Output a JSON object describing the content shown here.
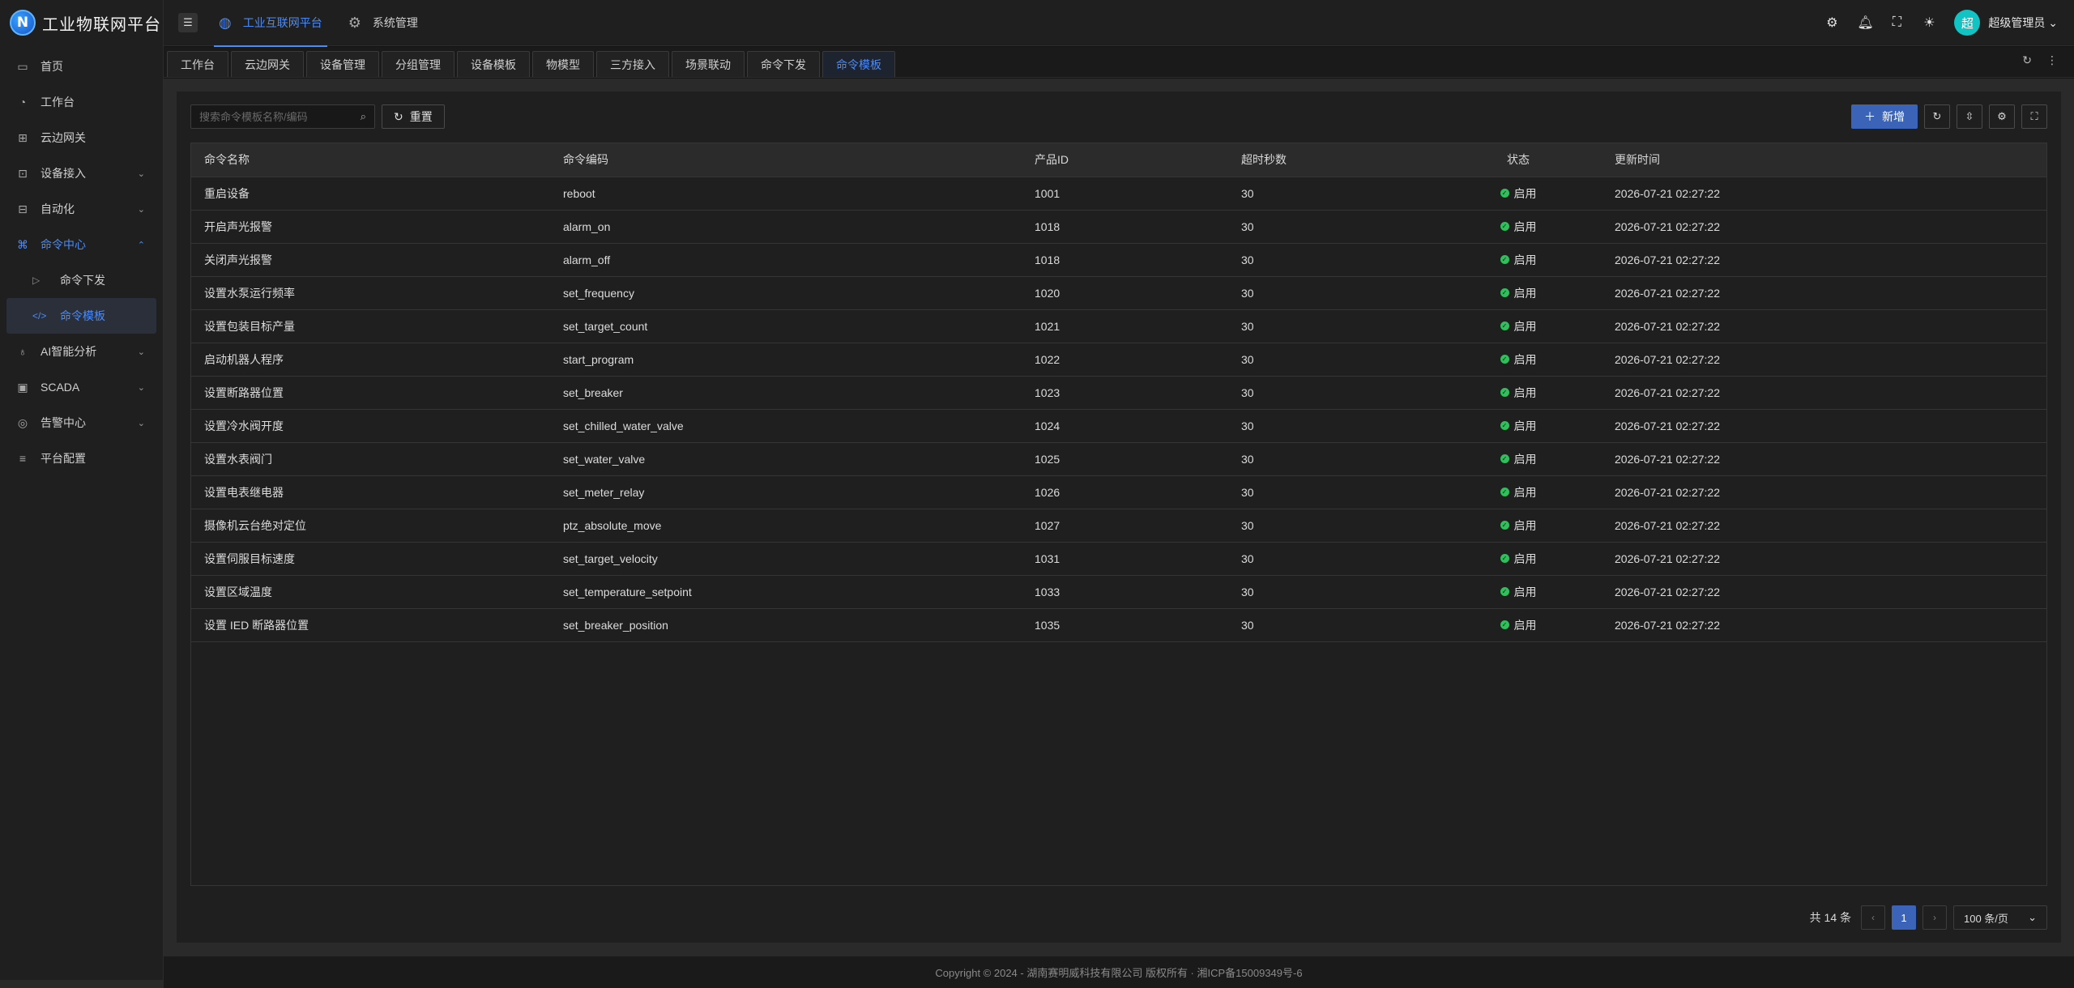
{
  "app": {
    "title": "工业物联网平台",
    "logo_letter": "N"
  },
  "sidebar": {
    "items": [
      {
        "label": "首页",
        "icon": "monitor-icon"
      },
      {
        "label": "工作台",
        "icon": "dashboard-icon"
      },
      {
        "label": "云边网关",
        "icon": "gateway-icon"
      },
      {
        "label": "设备接入",
        "icon": "device-icon",
        "expandable": true
      },
      {
        "label": "自动化",
        "icon": "automation-icon",
        "expandable": true
      },
      {
        "label": "命令中心",
        "icon": "command-icon",
        "expandable": true,
        "expanded": true,
        "children": [
          {
            "label": "命令下发",
            "icon": "send-icon"
          },
          {
            "label": "命令模板",
            "icon": "code-icon",
            "active": true
          }
        ]
      },
      {
        "label": "AI智能分析",
        "icon": "bulb-icon",
        "expandable": true
      },
      {
        "label": "SCADA",
        "icon": "scada-icon",
        "expandable": true
      },
      {
        "label": "告警中心",
        "icon": "alarm-icon",
        "expandable": true
      },
      {
        "label": "平台配置",
        "icon": "sliders-icon"
      }
    ]
  },
  "header": {
    "tabs": [
      {
        "label": "工业互联网平台",
        "icon": "platform-icon",
        "active": true
      },
      {
        "label": "系统管理",
        "icon": "gear-icon"
      }
    ],
    "user": {
      "avatar_text": "超",
      "name": "超级管理员"
    },
    "icons": [
      "settings-icon",
      "bell-icon",
      "fullscreen-icon",
      "theme-icon"
    ]
  },
  "tabs": [
    "工作台",
    "云边网关",
    "设备管理",
    "分组管理",
    "设备模板",
    "物模型",
    "三方接入",
    "场景联动",
    "命令下发",
    "命令模板"
  ],
  "active_tab": "命令模板",
  "toolbar": {
    "search_placeholder": "搜索命令模板名称/编码",
    "reset_label": "重置",
    "add_label": "新增"
  },
  "table": {
    "columns": [
      "命令名称",
      "命令编码",
      "产品ID",
      "超时秒数",
      "状态",
      "更新时间"
    ],
    "rows": [
      {
        "name": "重启设备",
        "code": "reboot",
        "product_id": "1001",
        "timeout": "30",
        "status": "启用",
        "updated": "2026-07-21 02:27:22"
      },
      {
        "name": "开启声光报警",
        "code": "alarm_on",
        "product_id": "1018",
        "timeout": "30",
        "status": "启用",
        "updated": "2026-07-21 02:27:22"
      },
      {
        "name": "关闭声光报警",
        "code": "alarm_off",
        "product_id": "1018",
        "timeout": "30",
        "status": "启用",
        "updated": "2026-07-21 02:27:22"
      },
      {
        "name": "设置水泵运行频率",
        "code": "set_frequency",
        "product_id": "1020",
        "timeout": "30",
        "status": "启用",
        "updated": "2026-07-21 02:27:22"
      },
      {
        "name": "设置包装目标产量",
        "code": "set_target_count",
        "product_id": "1021",
        "timeout": "30",
        "status": "启用",
        "updated": "2026-07-21 02:27:22"
      },
      {
        "name": "启动机器人程序",
        "code": "start_program",
        "product_id": "1022",
        "timeout": "30",
        "status": "启用",
        "updated": "2026-07-21 02:27:22"
      },
      {
        "name": "设置断路器位置",
        "code": "set_breaker",
        "product_id": "1023",
        "timeout": "30",
        "status": "启用",
        "updated": "2026-07-21 02:27:22"
      },
      {
        "name": "设置冷水阀开度",
        "code": "set_chilled_water_valve",
        "product_id": "1024",
        "timeout": "30",
        "status": "启用",
        "updated": "2026-07-21 02:27:22"
      },
      {
        "name": "设置水表阀门",
        "code": "set_water_valve",
        "product_id": "1025",
        "timeout": "30",
        "status": "启用",
        "updated": "2026-07-21 02:27:22"
      },
      {
        "name": "设置电表继电器",
        "code": "set_meter_relay",
        "product_id": "1026",
        "timeout": "30",
        "status": "启用",
        "updated": "2026-07-21 02:27:22"
      },
      {
        "name": "摄像机云台绝对定位",
        "code": "ptz_absolute_move",
        "product_id": "1027",
        "timeout": "30",
        "status": "启用",
        "updated": "2026-07-21 02:27:22"
      },
      {
        "name": "设置伺服目标速度",
        "code": "set_target_velocity",
        "product_id": "1031",
        "timeout": "30",
        "status": "启用",
        "updated": "2026-07-21 02:27:22"
      },
      {
        "name": "设置区域温度",
        "code": "set_temperature_setpoint",
        "product_id": "1033",
        "timeout": "30",
        "status": "启用",
        "updated": "2026-07-21 02:27:22"
      },
      {
        "name": "设置 IED 断路器位置",
        "code": "set_breaker_position",
        "product_id": "1035",
        "timeout": "30",
        "status": "启用",
        "updated": "2026-07-21 02:27:22"
      }
    ]
  },
  "pagination": {
    "total_text": "共 14 条",
    "current_page": "1",
    "page_size": "100 条/页"
  },
  "footer": {
    "text": "Copyright © 2024 - 湖南赛明威科技有限公司 版权所有 · 湘ICP备15009349号-6"
  },
  "colors": {
    "accent": "#4c8bf5",
    "primary_button": "#3b64b8",
    "status_ok": "#2fbf5b"
  }
}
